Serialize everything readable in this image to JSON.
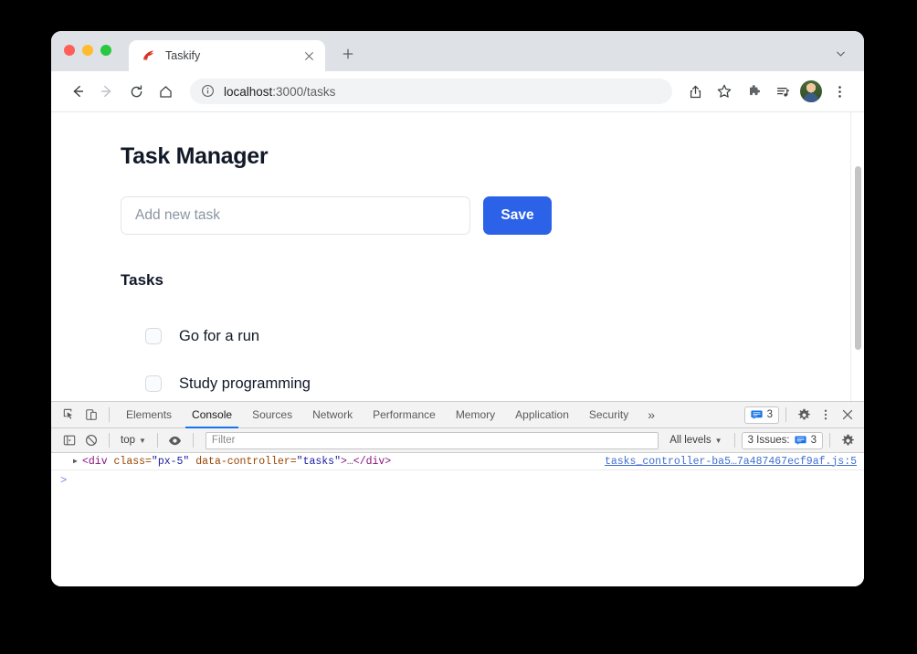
{
  "browser": {
    "tab": {
      "title": "Taskify",
      "favicon": "rails-logo-icon",
      "close": "×"
    },
    "new_tab_label": "+",
    "tabstrip_menu": "chevron-down-icon",
    "toolbar": {
      "back": "←",
      "forward": "→",
      "reload": "⟳",
      "home": "⌂",
      "url": "localhost",
      "url_rest": ":3000/tasks",
      "url_full": "localhost:3000/tasks",
      "info_icon": "info-circle-icon",
      "share_icon": "share-icon",
      "bookmark_icon": "star-icon",
      "extensions_icon": "puzzle-icon",
      "media_icon": "media-playlist-icon",
      "avatar": "profile-avatar",
      "menu_icon": "kebab-menu-icon"
    }
  },
  "page": {
    "title": "Task Manager",
    "input_placeholder": "Add new task",
    "input_value": "",
    "save_label": "Save",
    "tasks_heading": "Tasks",
    "tasks": [
      {
        "label": "Go for a run",
        "checked": false
      },
      {
        "label": "Study programming",
        "checked": false
      }
    ]
  },
  "devtools": {
    "inspect_icon": "inspect-element-icon",
    "device_icon": "device-toolbar-icon",
    "tabs": [
      {
        "label": "Elements",
        "active": false
      },
      {
        "label": "Console",
        "active": true
      },
      {
        "label": "Sources",
        "active": false
      },
      {
        "label": "Network",
        "active": false
      },
      {
        "label": "Performance",
        "active": false
      },
      {
        "label": "Memory",
        "active": false
      },
      {
        "label": "Application",
        "active": false
      },
      {
        "label": "Security",
        "active": false
      }
    ],
    "more_tabs": "»",
    "issues_count": "3",
    "settings_icon": "gear-icon",
    "menu_icon": "kebab-menu-icon",
    "close_icon": "close-icon",
    "console_bar": {
      "sidebar_icon": "console-sidebar-icon",
      "clear_icon": "clear-console-icon",
      "context": "top",
      "eye_icon": "live-expression-icon",
      "filter_placeholder": "Filter",
      "filter_value": "",
      "levels": "All levels",
      "issues_label": "3 Issues:",
      "issues_badge": "3",
      "settings_icon": "gear-icon"
    },
    "log": {
      "disclosure": "▶",
      "open_tag": "<div",
      "attr1_name": " class=",
      "attr1_value": "\"px-5\"",
      "attr2_name": " data-controller=",
      "attr2_value": "\"tasks\"",
      "tag_end": ">",
      "ellipsis": "…",
      "close_tag": "</div>",
      "source": "tasks_controller-ba5…7a487467ecf9af.js:5"
    },
    "prompt": ">"
  }
}
